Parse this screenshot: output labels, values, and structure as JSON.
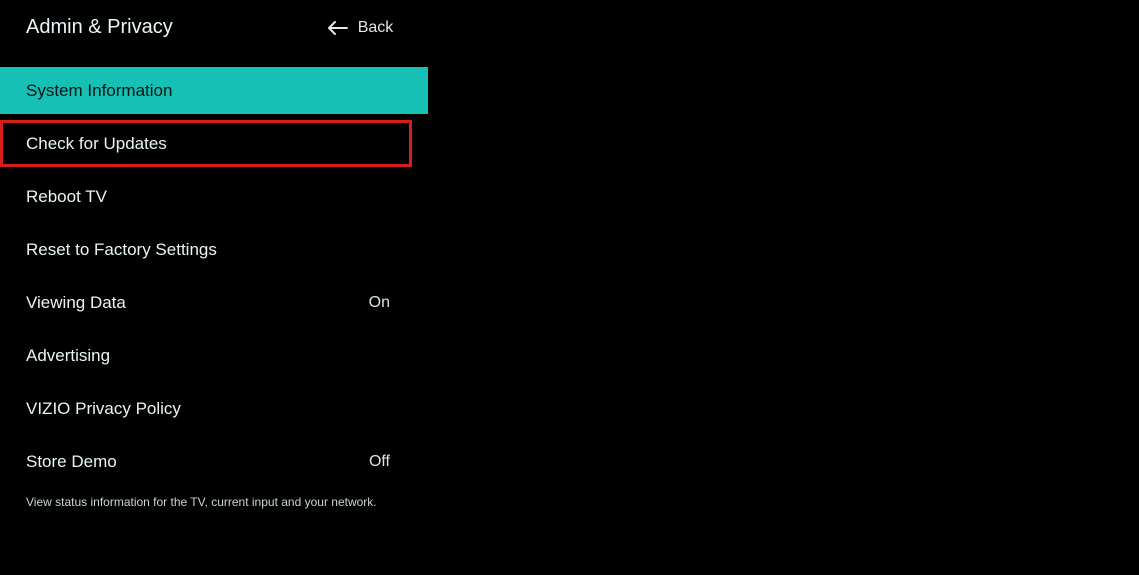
{
  "header": {
    "title": "Admin & Privacy",
    "back_label": "Back"
  },
  "menu": {
    "items": [
      {
        "label": "System Information",
        "value": "",
        "state": "selected"
      },
      {
        "label": "Check for Updates",
        "value": "",
        "state": "highlighted"
      },
      {
        "label": "Reboot TV",
        "value": "",
        "state": ""
      },
      {
        "label": "Reset to Factory Settings",
        "value": "",
        "state": ""
      },
      {
        "label": "Viewing Data",
        "value": "On",
        "state": ""
      },
      {
        "label": "Advertising",
        "value": "",
        "state": ""
      },
      {
        "label": "VIZIO Privacy Policy",
        "value": "",
        "state": ""
      },
      {
        "label": "Store Demo",
        "value": "Off",
        "state": ""
      }
    ]
  },
  "description": "View status information for the TV, current input and your network."
}
